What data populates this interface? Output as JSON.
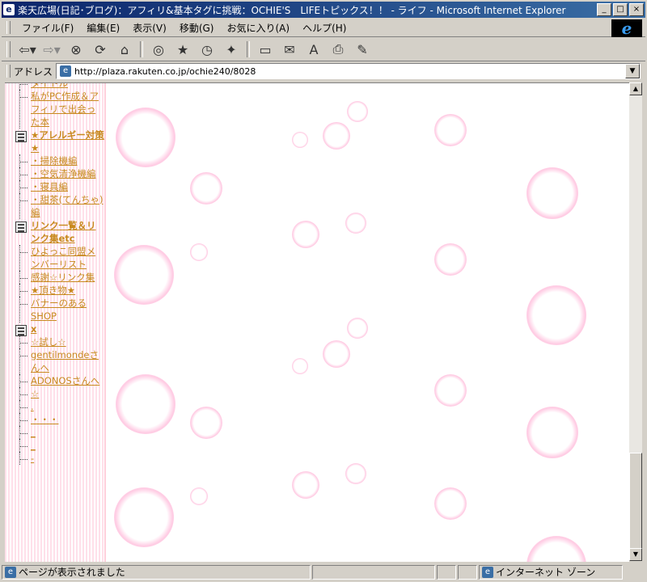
{
  "window": {
    "title": "楽天広場(日記･ブログ)：アフィリ&基本タグに挑戦：OCHIE'S　LIFEトピックス！！ - ライフ - Microsoft Internet Explorer",
    "icon": "ie-icon"
  },
  "menu": {
    "items": [
      "ファイル(F)",
      "編集(E)",
      "表示(V)",
      "移動(G)",
      "お気に入り(A)",
      "ヘルプ(H)"
    ]
  },
  "toolbar": {
    "buttons": [
      "back-icon",
      "forward-icon",
      "stop-icon",
      "refresh-icon",
      "home-icon",
      "search-icon",
      "favorites-icon",
      "history-icon",
      "channels-icon",
      "fullscreen-icon",
      "mail-icon",
      "font-icon",
      "print-icon",
      "edit-icon"
    ]
  },
  "address": {
    "label": "アドレス",
    "url": "http://plaza.rakuten.co.jp/ochie240/8028"
  },
  "sidebar": {
    "items": [
      {
        "text": "タイトル",
        "type": "leaf"
      },
      {
        "text": "私がPC作成＆アフィリで出会った本",
        "type": "leaf"
      },
      {
        "text": "★アレルギー対策★",
        "type": "category"
      },
      {
        "text": "・掃除機編",
        "type": "leaf"
      },
      {
        "text": "・空気清浄機編",
        "type": "leaf"
      },
      {
        "text": "・寝具編",
        "type": "leaf"
      },
      {
        "text": "・甜茶(てんちゃ)編",
        "type": "leaf"
      },
      {
        "text": "リンク一覧＆リンク集etc",
        "type": "category"
      },
      {
        "text": "ひよっこ同盟メンバーリスト",
        "type": "leaf"
      },
      {
        "text": "感謝☆リンク集",
        "type": "leaf"
      },
      {
        "text": "★頂き物★",
        "type": "leaf"
      },
      {
        "text": "バナーのあるSHOP",
        "type": "leaf"
      },
      {
        "text": "x",
        "type": "category"
      },
      {
        "text": "☆試し☆",
        "type": "leaf"
      },
      {
        "text": "gentilmondeさんへ",
        "type": "leaf"
      },
      {
        "text": "ADONOSさんへ",
        "type": "leaf"
      },
      {
        "text": "☆",
        "type": "leaf"
      },
      {
        "text": ".",
        "type": "leaf"
      },
      {
        "text": "・・・",
        "type": "leaf"
      },
      {
        "text": "",
        "type": "leaf"
      },
      {
        "text": "_",
        "type": "leaf"
      },
      {
        "text": "_",
        "type": "leaf"
      },
      {
        "text": "-",
        "type": "leaf"
      }
    ]
  },
  "status": {
    "text": "ページが表示されました",
    "zone": "インターネット ゾーン"
  },
  "colors": {
    "link": "#c8891f",
    "titlebar": "#0a246a",
    "bubble": "#ffbedc"
  }
}
